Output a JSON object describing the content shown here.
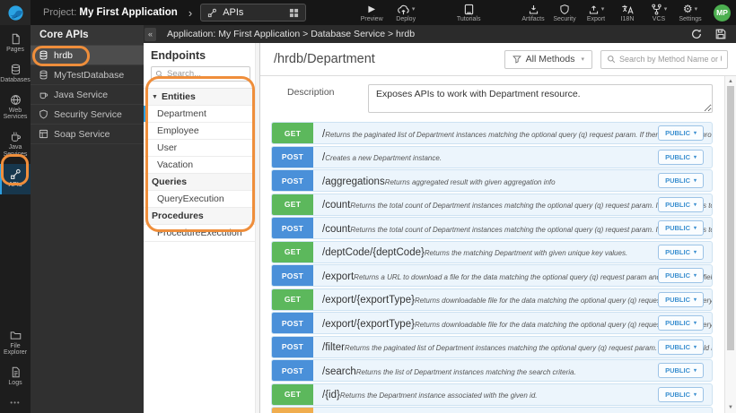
{
  "colors": {
    "annotation_orange": "#ef8e3b",
    "get_badge": "#5cb85c",
    "post_badge": "#4a90d9",
    "put_badge": "#f0ad4e",
    "public_button_text": "#3c90d0",
    "selected_indicator_blue": "#2e9fe0",
    "avatar_bg": "#4caf50"
  },
  "glyphs": {
    "caret_down": "▾",
    "chevron_right": "›",
    "collapse_left": "«",
    "play": "▶",
    "gear": "⚙",
    "scroll_up": "▲",
    "scroll_down": "▼",
    "more_dots": "•••",
    "tree_caret": "▼"
  },
  "topbar": {
    "project_label": "Project:",
    "project_name": "My First Application",
    "tab_label": "APIs",
    "left_actions": [
      {
        "label": "Preview",
        "caret": false
      },
      {
        "label": "Deploy",
        "caret": true
      },
      {
        "label": "Tutorials",
        "caret": false
      }
    ],
    "right_actions": [
      {
        "label": "Artifacts",
        "caret": false
      },
      {
        "label": "Security",
        "caret": false
      },
      {
        "label": "Export",
        "caret": true
      },
      {
        "label": "I18N",
        "caret": false
      },
      {
        "label": "VCS",
        "caret": true
      },
      {
        "label": "Settings",
        "caret": true
      }
    ],
    "avatar_initials": "MP"
  },
  "rail": {
    "items": [
      {
        "label": "Pages"
      },
      {
        "label": "Databases"
      },
      {
        "label": "Web Services"
      },
      {
        "label": "Java Services"
      },
      {
        "label": "APIs"
      }
    ],
    "bottom_items": [
      {
        "label": "File Explorer"
      },
      {
        "label": "Logs"
      }
    ]
  },
  "core_panel": {
    "title": "Core APIs",
    "items": [
      {
        "label": "hrdb"
      },
      {
        "label": "MyTestDatabase"
      },
      {
        "label": "Java Service"
      },
      {
        "label": "Security Service"
      },
      {
        "label": "Soap Service"
      }
    ]
  },
  "breadcrumb": {
    "text": "Application: My First Application > Database Service > hrdb"
  },
  "endpoints": {
    "title": "Endpoints",
    "search_placeholder": "Search...",
    "tree": [
      {
        "label": "Entities",
        "type": "group"
      },
      {
        "label": "Department",
        "type": "item",
        "selected": true
      },
      {
        "label": "Employee",
        "type": "item"
      },
      {
        "label": "User",
        "type": "item"
      },
      {
        "label": "Vacation",
        "type": "item"
      },
      {
        "label": "Queries",
        "type": "group"
      },
      {
        "label": "QueryExecution",
        "type": "item"
      },
      {
        "label": "Procedures",
        "type": "group"
      },
      {
        "label": "ProcedureExecution",
        "type": "item"
      }
    ]
  },
  "content": {
    "title": "/hrdb/Department",
    "methods_filter": "All Methods",
    "search_placeholder": "Search by Method Name or URL...",
    "description_label": "Description",
    "description_value": "Exposes APIs to work with Department resource.",
    "api_rows": [
      {
        "method": "GET",
        "path": "/",
        "description": "Returns the paginated list of Department instances matching the optional query (q) request param. If there is no query pro...",
        "access": "PUBLIC"
      },
      {
        "method": "POST",
        "path": "/",
        "description": "Creates a new Department instance.",
        "access": "PUBLIC"
      },
      {
        "method": "POST",
        "path": "/aggregations",
        "description": "Returns aggregated result with given aggregation info",
        "access": "PUBLIC"
      },
      {
        "method": "GET",
        "path": "/count",
        "description": "Returns the total count of Department instances matching the optional query (q) request param. If query string is too big t...",
        "access": "PUBLIC"
      },
      {
        "method": "POST",
        "path": "/count",
        "description": "Returns the total count of Department instances matching the optional query (q) request param. If query string is too big t...",
        "access": "PUBLIC"
      },
      {
        "method": "GET",
        "path": "/deptCode/{deptCode}",
        "description": "Returns the matching Department with given unique key values.",
        "access": "PUBLIC"
      },
      {
        "method": "POST",
        "path": "/export",
        "description": "Returns a URL to download a file for the data matching the optional query (q) request param and the required fields provid...",
        "access": "PUBLIC"
      },
      {
        "method": "GET",
        "path": "/export/{exportType}",
        "description": "Returns downloadable file for the data matching the optional query (q) request param. If query string is too big to fit in GET...",
        "access": "PUBLIC"
      },
      {
        "method": "POST",
        "path": "/export/{exportType}",
        "description": "Returns downloadable file for the data matching the optional query (q) request param. If query string is too big to fit in GET...",
        "access": "PUBLIC"
      },
      {
        "method": "POST",
        "path": "/filter",
        "description": "Returns the paginated list of Department instances matching the optional query (q) request param. This API should be use...",
        "access": "PUBLIC"
      },
      {
        "method": "POST",
        "path": "/search",
        "description": "Returns the list of Department instances matching the search criteria.",
        "access": "PUBLIC"
      },
      {
        "method": "GET",
        "path": "/{id}",
        "description": "Returns the Department instance associated with the given id.",
        "access": "PUBLIC"
      }
    ],
    "partial_row": {
      "method": "PUT"
    }
  }
}
